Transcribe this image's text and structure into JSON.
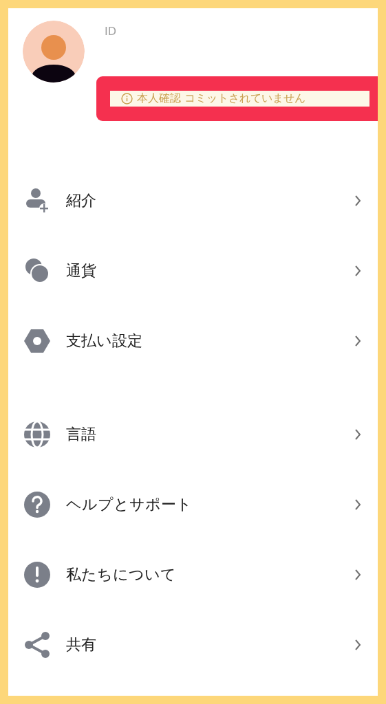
{
  "profile": {
    "id_label": "ID",
    "notice": "本人確認 コミットされていません"
  },
  "sections": [
    {
      "items": [
        {
          "label": "紹介"
        },
        {
          "label": "通貨"
        },
        {
          "label": "支払い設定"
        }
      ]
    },
    {
      "items": [
        {
          "label": "言語"
        },
        {
          "label": "ヘルプとサポート"
        },
        {
          "label": "私たちについて"
        },
        {
          "label": "共有"
        }
      ]
    }
  ]
}
